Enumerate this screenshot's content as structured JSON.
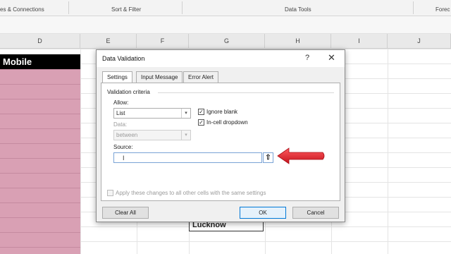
{
  "ribbon": {
    "groups": [
      "es & Connections",
      "Sort & Filter",
      "Data Tools",
      "Forec"
    ]
  },
  "columns": [
    "D",
    "E",
    "F",
    "G",
    "H",
    "I",
    "J"
  ],
  "cells": {
    "header": "Mobile",
    "lucknow": "Lucknow"
  },
  "dialog": {
    "title": "Data Validation",
    "help": "?",
    "close": "✕",
    "tabs": [
      "Settings",
      "Input Message",
      "Error Alert"
    ],
    "validation_criteria": "Validation criteria",
    "allow_label": "Allow:",
    "allow_value": "List",
    "ignore_blank": "Ignore blank",
    "in_cell_dropdown": "In-cell dropdown",
    "data_label": "Data:",
    "data_value": "between",
    "source_label": "Source:",
    "source_value": "",
    "apply_all": "Apply these changes to all other cells with the same settings",
    "clear_all": "Clear All",
    "ok": "OK",
    "cancel": "Cancel",
    "ignore_blank_checked": true,
    "in_cell_dropdown_checked": true,
    "apply_all_checked": false
  },
  "colors": {
    "arrow": "#e0202c",
    "pink_fill": "#d9a0b4"
  }
}
